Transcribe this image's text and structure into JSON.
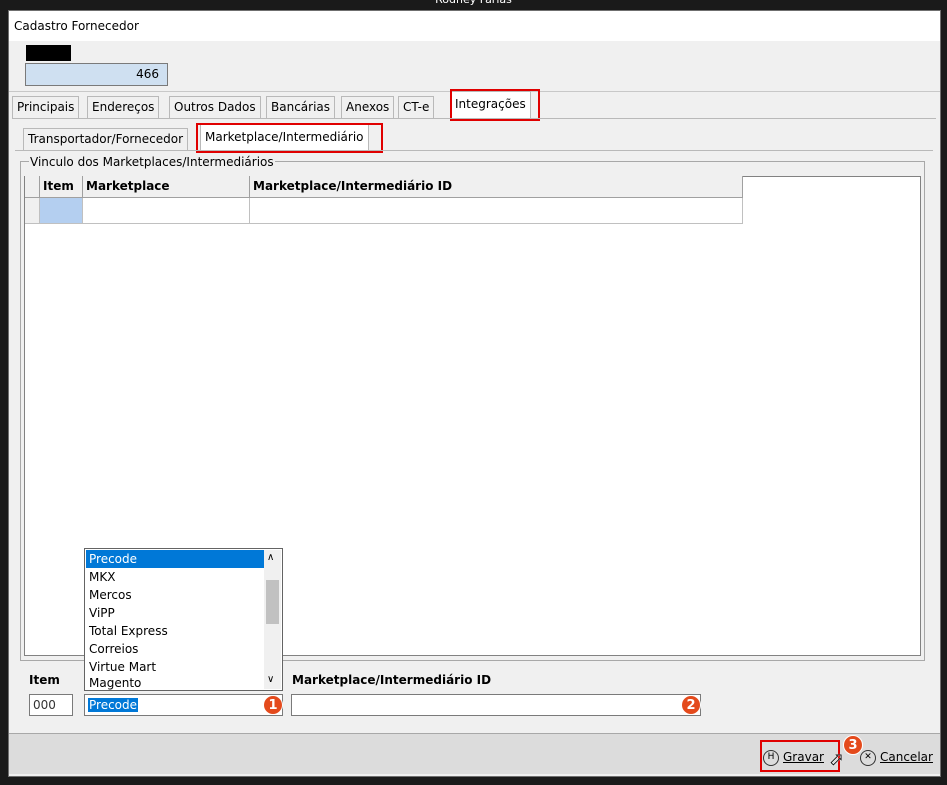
{
  "caption": "Rodney Farias",
  "window": {
    "title": "Cadastro Fornecedor",
    "code_value": "466"
  },
  "tabs": [
    {
      "label": "Principais"
    },
    {
      "label": "Endereços"
    },
    {
      "label": "Outros Dados"
    },
    {
      "label": "Bancárias"
    },
    {
      "label": "Anexos"
    },
    {
      "label": "CT-e"
    },
    {
      "label": "Integrações",
      "active": true
    }
  ],
  "subtabs": [
    {
      "label": "Transportador/Fornecedor"
    },
    {
      "label": "Marketplace/Intermediário",
      "active": true
    }
  ],
  "group": {
    "label": "Vinculo dos Marketplaces/Intermediários",
    "columns": [
      "Item",
      "Marketplace",
      "Marketplace/Intermediário ID"
    ]
  },
  "form": {
    "item_label": "Item",
    "item_value": "000",
    "marketplace_value": "Precode",
    "id_label": "Marketplace/Intermediário ID",
    "id_value": ""
  },
  "dropdown": {
    "options": [
      "Precode",
      "MKX",
      "Mercos",
      "ViPP",
      "Total Express",
      "Correios",
      "Virtue Mart",
      "Magento"
    ],
    "selected": "Precode"
  },
  "badges": [
    "1",
    "2",
    "3"
  ],
  "buttons": {
    "save_label": "Gravar",
    "cancel_label": "Cancelar"
  },
  "colors": {
    "highlight_box": "#e00000",
    "badge": "#e44a1c",
    "selection": "#0078d7"
  }
}
